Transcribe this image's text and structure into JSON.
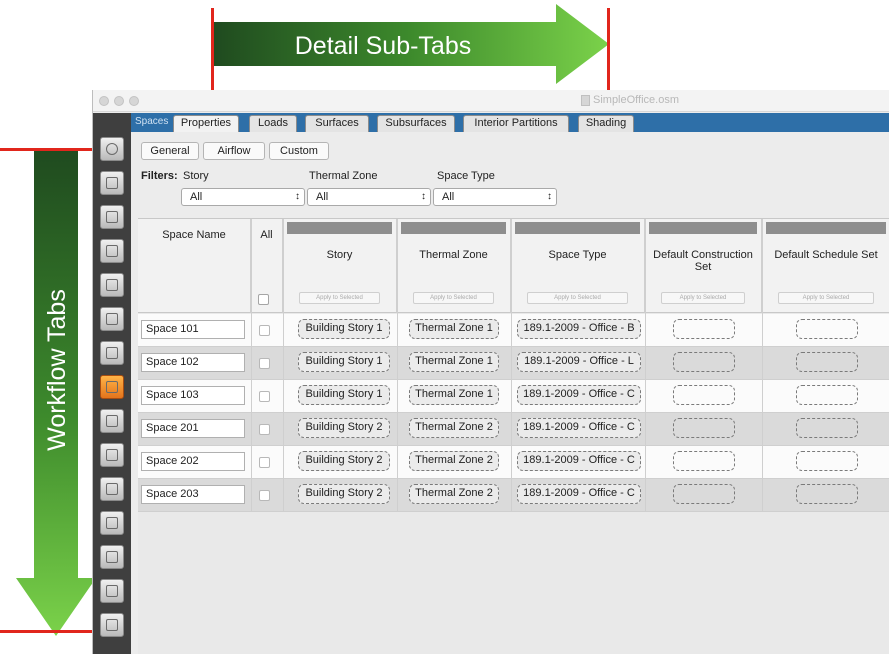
{
  "annotations": {
    "detail_subtabs": "Detail Sub-Tabs",
    "workflow_tabs": "Workflow Tabs"
  },
  "window": {
    "title": "SimpleOffice.osm"
  },
  "tabs": {
    "spaces": "Spaces",
    "subtabs": [
      "Properties",
      "Loads",
      "Surfaces",
      "Subsurfaces",
      "Interior Partitions",
      "Shading"
    ],
    "active": "Properties"
  },
  "workflow_tabs": [
    "site",
    "schedules",
    "constructions",
    "loads",
    "space-types",
    "geometry",
    "facility",
    "spaces",
    "thermal-zones",
    "hvac",
    "variables",
    "simulation-settings",
    "measures",
    "run",
    "results"
  ],
  "buttons": {
    "general": "General",
    "airflow": "Airflow",
    "custom": "Custom"
  },
  "filters": {
    "label": "Filters:",
    "story_label": "Story",
    "story_value": "All",
    "zone_label": "Thermal Zone",
    "zone_value": "All",
    "type_label": "Space Type",
    "type_value": "All"
  },
  "table": {
    "headers": {
      "name": "Space Name",
      "all": "All",
      "story": "Story",
      "zone": "Thermal Zone",
      "type": "Space Type",
      "construction": "Default Construction Set",
      "schedule": "Default Schedule Set"
    },
    "apply_label": "Apply to Selected",
    "rows": [
      {
        "name": "Space 101",
        "story": "Building Story 1",
        "zone": "Thermal Zone 1",
        "type": "189.1-2009 - Office - B"
      },
      {
        "name": "Space 102",
        "story": "Building Story 1",
        "zone": "Thermal Zone 1",
        "type": "189.1-2009 - Office - L"
      },
      {
        "name": "Space 103",
        "story": "Building Story 1",
        "zone": "Thermal Zone 1",
        "type": "189.1-2009 - Office - C"
      },
      {
        "name": "Space 201",
        "story": "Building Story 2",
        "zone": "Thermal Zone 2",
        "type": "189.1-2009 - Office - C"
      },
      {
        "name": "Space 202",
        "story": "Building Story 2",
        "zone": "Thermal Zone 2",
        "type": "189.1-2009 - Office - C"
      },
      {
        "name": "Space 203",
        "story": "Building Story 2",
        "zone": "Thermal Zone 2",
        "type": "189.1-2009 - Office - C"
      }
    ]
  }
}
